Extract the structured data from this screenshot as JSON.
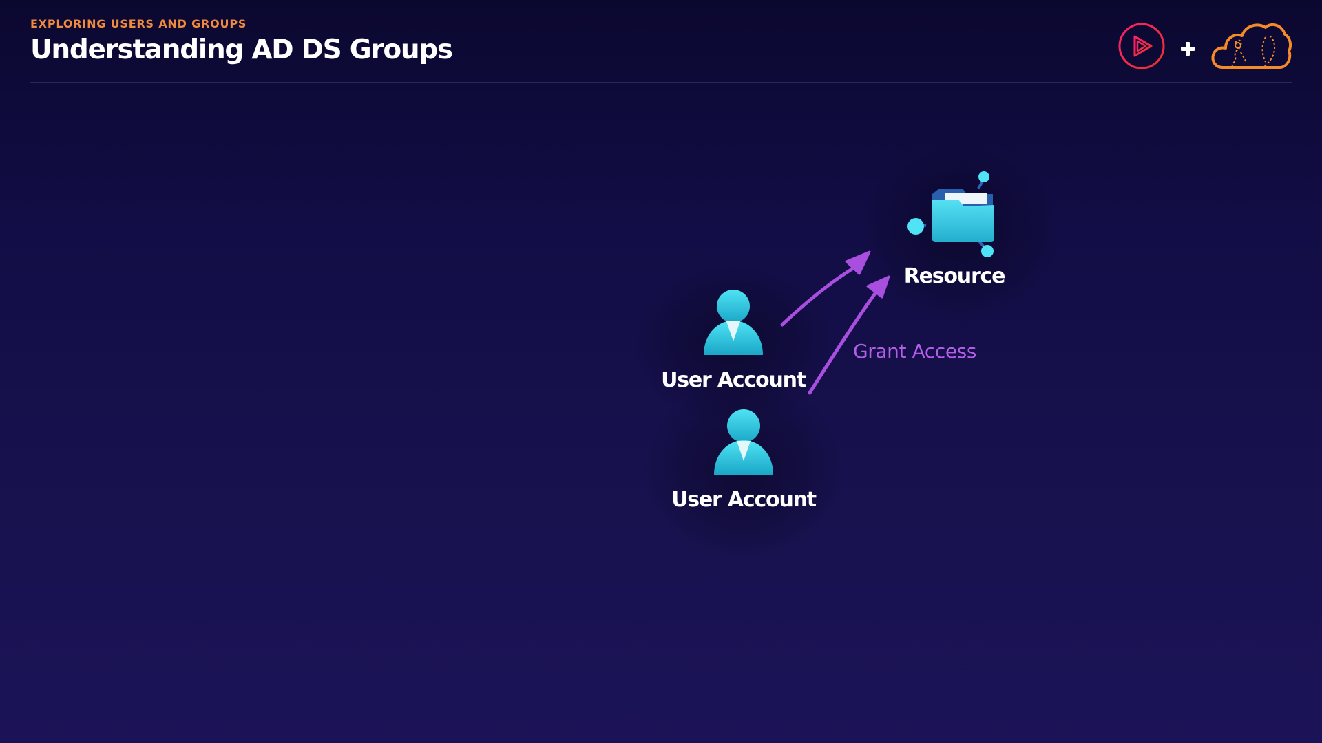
{
  "header": {
    "eyebrow": "EXPLORING USERS AND GROUPS",
    "title": "Understanding AD DS Groups"
  },
  "logos": {
    "left": "play-logo-icon",
    "separator": "+",
    "right": "cloud-logo-icon"
  },
  "diagram": {
    "nodes": [
      {
        "id": "resource",
        "label": "Resource",
        "icon": "shared-folder-icon"
      },
      {
        "id": "user1",
        "label": "User Account",
        "icon": "user-icon"
      },
      {
        "id": "user2",
        "label": "User Account",
        "icon": "user-icon"
      }
    ],
    "edges": [
      {
        "from": "user1",
        "to": "resource"
      },
      {
        "from": "user2",
        "to": "resource"
      }
    ],
    "edge_label": "Grant Access"
  },
  "colors": {
    "accent_orange": "#f08a3c",
    "arrow_purple": "#a94fe0",
    "icon_cyan": "#3dd6ee",
    "background": "#120d45"
  }
}
